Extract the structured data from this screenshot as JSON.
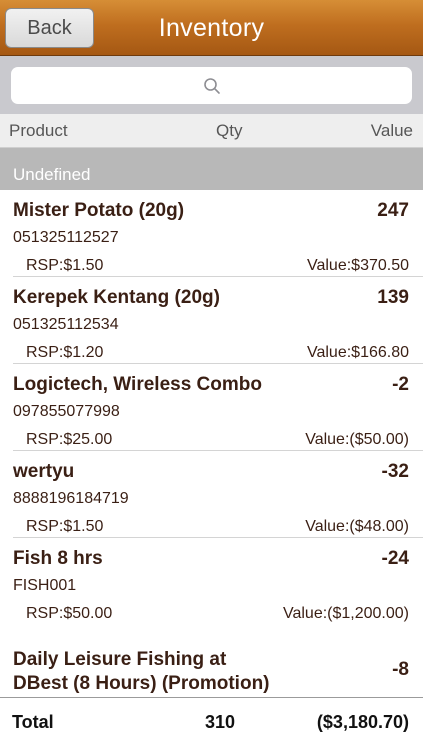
{
  "nav": {
    "back_label": "Back",
    "title": "Inventory"
  },
  "search": {
    "placeholder": "",
    "icon": "search-icon"
  },
  "columns": {
    "product": "Product",
    "qty": "Qty",
    "value": "Value"
  },
  "section": {
    "title": "Undefined"
  },
  "items": [
    {
      "name": "Mister Potato (20g)",
      "qty": "247",
      "code": "051325112527",
      "rsp": "RSP:$1.50",
      "value": "Value:$370.50"
    },
    {
      "name": "Kerepek Kentang (20g)",
      "qty": "139",
      "code": "051325112534",
      "rsp": "RSP:$1.20",
      "value": "Value:$166.80"
    },
    {
      "name": "Logictech, Wireless Combo",
      "qty": "-2",
      "code": "097855077998",
      "rsp": "RSP:$25.00",
      "value": "Value:($50.00)"
    },
    {
      "name": "wertyu",
      "qty": "-32",
      "code": "8888196184719",
      "rsp": "RSP:$1.50",
      "value": "Value:($48.00)"
    },
    {
      "name": "Fish 8 hrs",
      "qty": "-24",
      "code": "FISH001",
      "rsp": "RSP:$50.00",
      "value": "Value:($1,200.00)"
    },
    {
      "name_line1": "Daily Leisure Fishing at",
      "name_line2": "DBest (8 Hours)  (Promotion)",
      "qty": "-8"
    }
  ],
  "footer": {
    "label": "Total",
    "qty": "310",
    "value": "($3,180.70)"
  },
  "colors": {
    "navbar": "#bf6e1f",
    "text": "#3a1f14",
    "section_bg": "#b8b8b8"
  }
}
